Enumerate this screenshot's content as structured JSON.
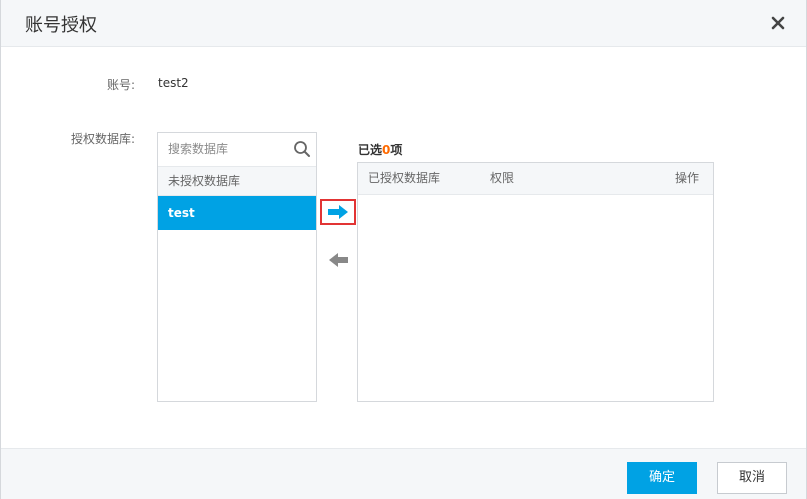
{
  "dialog": {
    "title": "账号授权"
  },
  "form": {
    "account_label": "账号:",
    "account_value": "test2",
    "db_label": "授权数据库:"
  },
  "left_list": {
    "search_placeholder": "搜索数据库",
    "header": "未授权数据库",
    "items": [
      {
        "label": "test",
        "selected": true
      }
    ]
  },
  "right_list": {
    "selected_prefix": "已选",
    "selected_count": "0",
    "selected_suffix": "项",
    "columns": [
      "已授权数据库",
      "权限",
      "操作"
    ]
  },
  "footer": {
    "confirm_label": "确定",
    "cancel_label": "取消"
  },
  "colors": {
    "accent": "#00a2e4",
    "count_highlight": "#ff6a00",
    "highlight_border": "#e23434"
  },
  "icons": {
    "close": "close-icon",
    "search": "search-icon",
    "move_right": "arrow-right-icon",
    "move_left": "arrow-left-icon"
  }
}
